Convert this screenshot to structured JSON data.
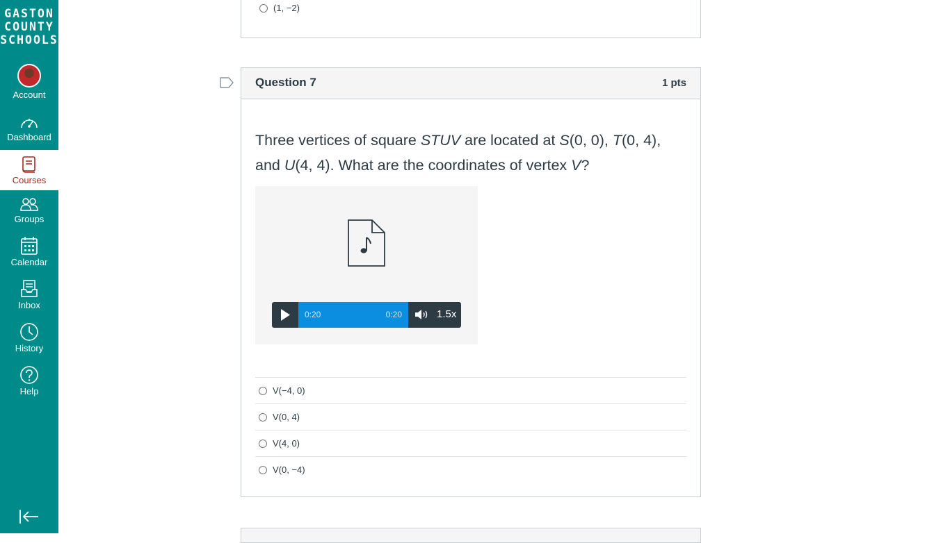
{
  "logo": {
    "lines": [
      "GASTON",
      "COUNTY",
      "SCHOOLS"
    ]
  },
  "nav": {
    "items": [
      {
        "label": "Account",
        "icon": "avatar"
      },
      {
        "label": "Dashboard",
        "icon": "dashboard-icon"
      },
      {
        "label": "Courses",
        "icon": "courses-icon",
        "active": true
      },
      {
        "label": "Groups",
        "icon": "groups-icon"
      },
      {
        "label": "Calendar",
        "icon": "calendar-icon"
      },
      {
        "label": "Inbox",
        "icon": "inbox-icon"
      },
      {
        "label": "History",
        "icon": "history-icon"
      },
      {
        "label": "Help",
        "icon": "help-icon"
      }
    ],
    "collapse_icon": "collapse-nav-icon"
  },
  "previous_question": {
    "last_answer": "(1, −2)"
  },
  "question": {
    "title": "Question 7",
    "points": "1 pts",
    "text_parts": [
      "Three vertices of square ",
      "STUV",
      " are located at ",
      "S",
      "(0, 0), ",
      "T",
      "(0, 4), and ",
      "U",
      "(4, 4). What are the coordinates of vertex ",
      "V",
      "?"
    ],
    "media": {
      "icon": "audio-file-icon",
      "current_time": "0:20",
      "duration": "0:20",
      "speed": "1.5x",
      "progress": 1.0
    },
    "answers": [
      "V(−4, 0)",
      "V(0, 4)",
      "V(4, 0)",
      "V(0, −4)"
    ]
  },
  "colors": {
    "nav_bg": "#008b8b",
    "active_nav_text": "#b0261d",
    "progress_bar": "#0b8ee0",
    "player_bg": "#2d3b45"
  }
}
